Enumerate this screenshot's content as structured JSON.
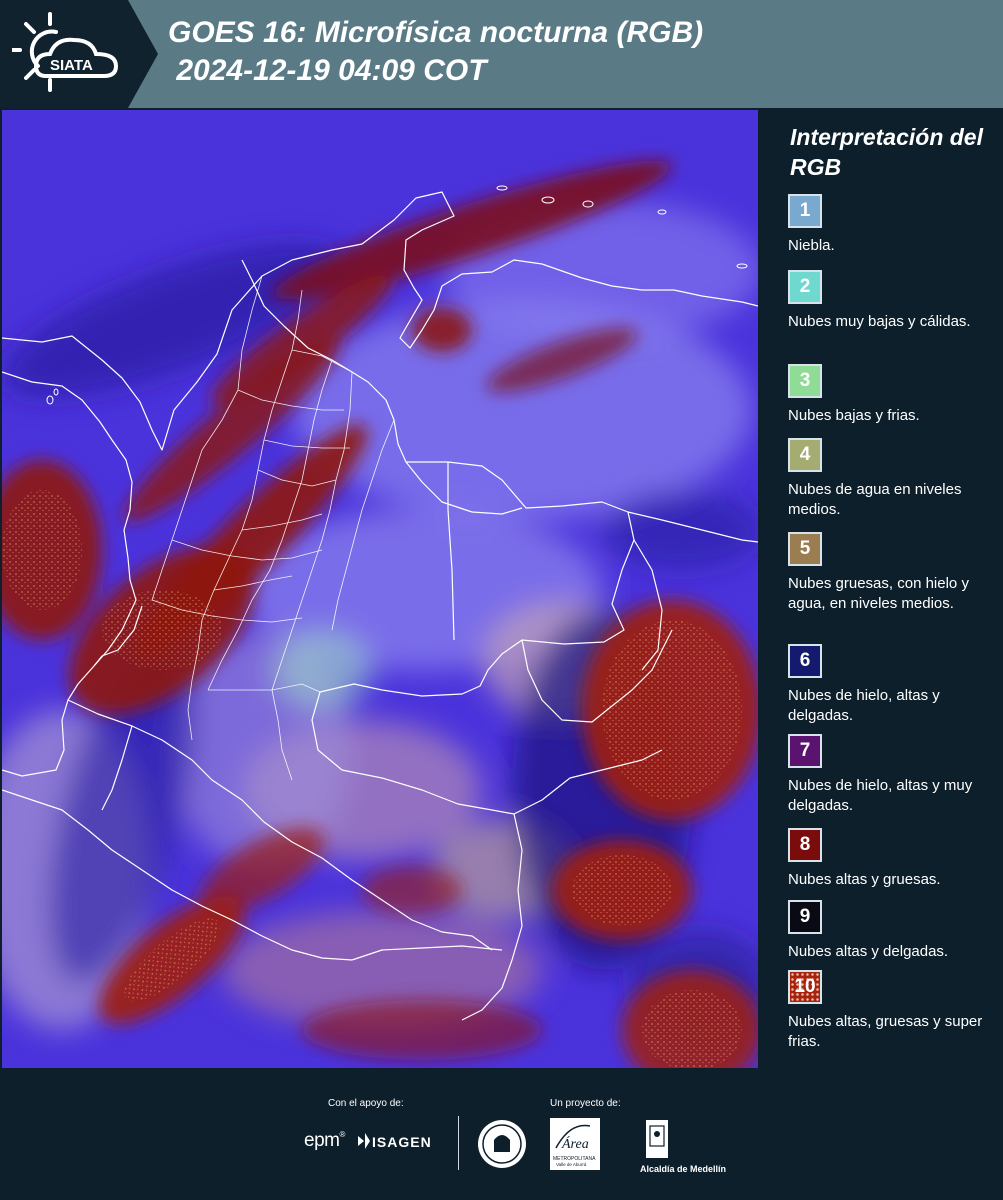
{
  "header": {
    "brand": "SIATA",
    "title_line1": "GOES 16: Microfísica nocturna (RGB)",
    "title_line2": " 2024-12-19 04:09 COT"
  },
  "legend": {
    "title": "Interpretación del RGB",
    "items": [
      {
        "number": "1",
        "color": "#7aa9cf",
        "text": "Niebla."
      },
      {
        "number": "2",
        "color": "#6fd9d0",
        "text": "Nubes muy bajas y cálidas."
      },
      {
        "number": "3",
        "color": "#8fdc96",
        "text": "Nubes bajas y frias."
      },
      {
        "number": "4",
        "color": "#a4ac72",
        "text": "Nubes de agua en niveles medios."
      },
      {
        "number": "5",
        "color": "#9b7d52",
        "text": "Nubes gruesas, con hielo y agua, en niveles medios."
      },
      {
        "number": "6",
        "color": "#141a6e",
        "text": "Nubes de hielo, altas y delgadas."
      },
      {
        "number": "7",
        "color": "#5a1470",
        "text": "Nubes de hielo, altas y muy delgadas."
      },
      {
        "number": "8",
        "color": "#7a0c0c",
        "text": "Nubes altas y gruesas."
      },
      {
        "number": "9",
        "color": "#0a0a14",
        "text": "Nubes altas y delgadas."
      },
      {
        "number": "10",
        "color": "#a82410",
        "text": "Nubes altas, gruesas y super frias."
      }
    ]
  },
  "footer": {
    "support_label": "Con el apoyo de:",
    "project_label": "Un proyecto de:",
    "sponsor_epm": "epm",
    "sponsor_isagen": "ISAGEN",
    "partner_area": "Área",
    "partner_area_sub1": "METROPOLITANA",
    "partner_area_sub2": "Valle de Aburrá",
    "partner_alcaldia": "Alcaldía de Medellín"
  }
}
